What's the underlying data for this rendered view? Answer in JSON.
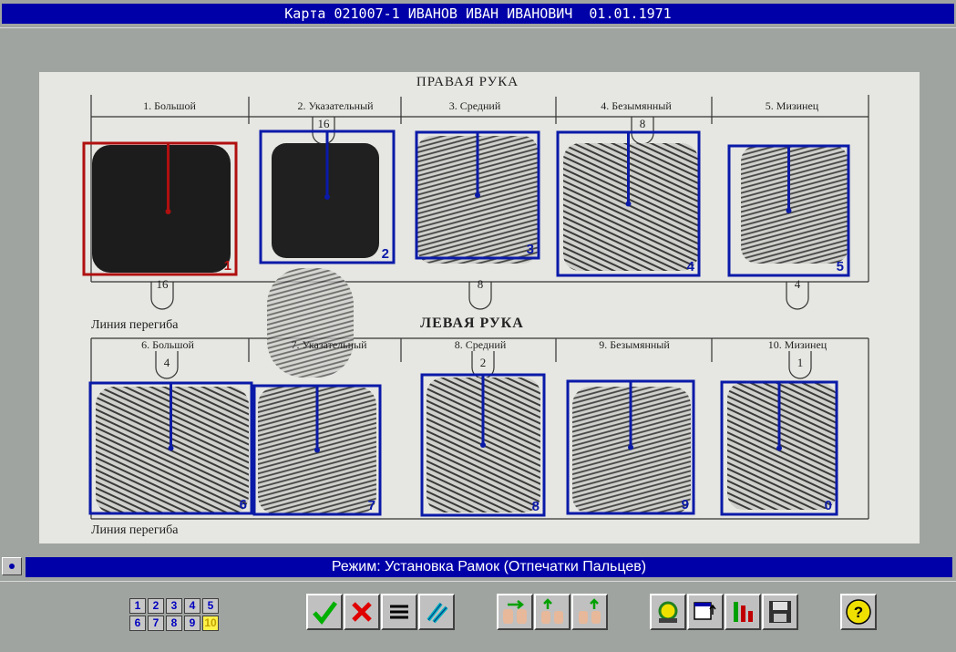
{
  "window": {
    "title": "Карта 021007-1 ИВАНОВ ИВАН ИВАНОВИЧ  01.01.1971"
  },
  "card": {
    "right_hand_title": "ПРАВАЯ РУКА",
    "left_hand_title": "ЛЕВАЯ РУКА",
    "fold_line_top": "Линия перегиба",
    "fold_line_bottom": "Линия перегиба",
    "right_fingers": [
      "1. Большой",
      "2. Указательный",
      "3. Средний",
      "4. Безымянный",
      "5. Мизинец"
    ],
    "left_fingers": [
      "6. Большой",
      "7. Указательный",
      "8. Средний",
      "9. Безымянный",
      "10. Мизинец"
    ],
    "right_top_codes": [
      "16",
      "8"
    ],
    "right_bottom_codes": [
      "16",
      "8",
      "4"
    ],
    "left_top_codes": [
      "4",
      "2",
      "1"
    ],
    "frame_labels": [
      "1",
      "2",
      "3",
      "4",
      "5",
      "6",
      "7",
      "8",
      "9",
      "0"
    ],
    "selected_frame": "1"
  },
  "status": {
    "mode": "Режим: Установка Рамок  (Отпечатки Пальцев)"
  },
  "toolbar": {
    "finger_numbers": [
      "1",
      "2",
      "3",
      "4",
      "5",
      "6",
      "7",
      "8",
      "9",
      "10"
    ],
    "active_number": "10",
    "buttons": [
      "check-icon",
      "cross-icon",
      "list-icon",
      "diagonal-lines-icon",
      "swap-hands-icon",
      "swap-fingers-up-icon",
      "rotate-icon",
      "window-icon",
      "tools-icon",
      "save-icon",
      "help-icon"
    ]
  },
  "colors": {
    "title_bg": "#0000a8",
    "frame_blue": "#0a1aa8",
    "frame_red": "#b01010",
    "window_bg": "#a0a4a0"
  }
}
